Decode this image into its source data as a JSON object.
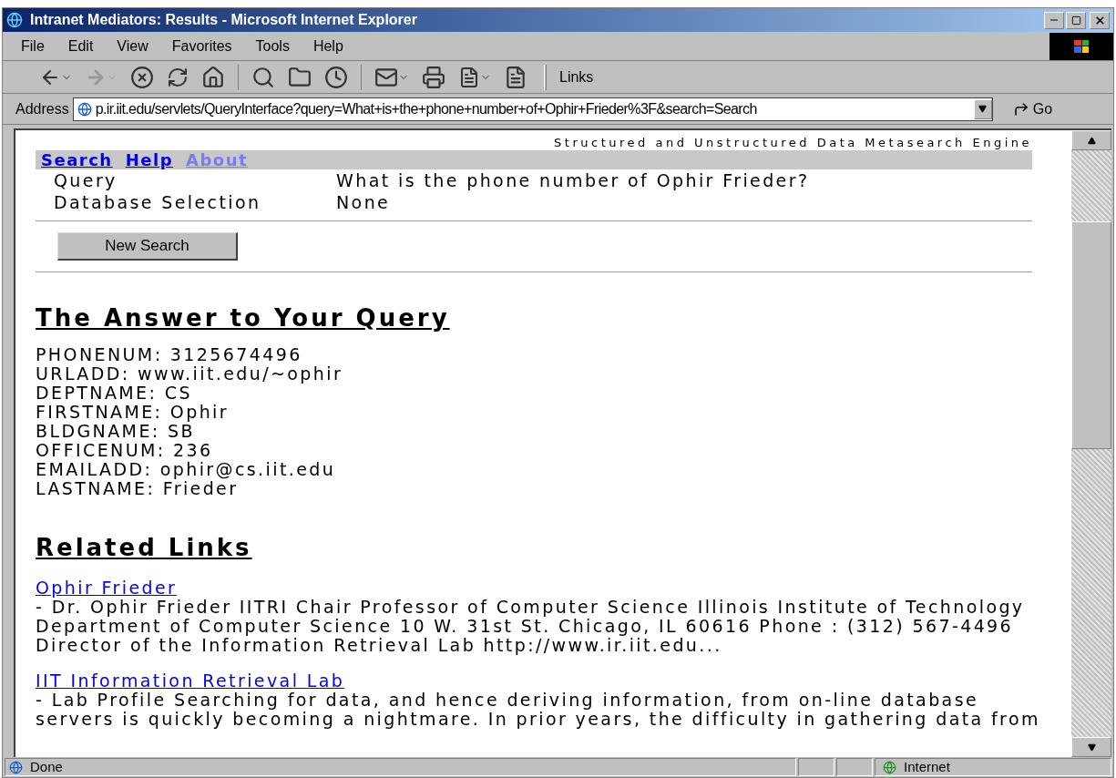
{
  "window": {
    "title": "Intranet Mediators: Results - Microsoft Internet Explorer"
  },
  "menu": [
    "File",
    "Edit",
    "View",
    "Favorites",
    "Tools",
    "Help"
  ],
  "toolbar": {
    "links_label": "Links"
  },
  "address": {
    "label": "Address",
    "value": "p.ir.iit.edu/servlets/QueryInterface?query=What+is+the+phone+number+of+Ophir+Frieder%3F&search=Search",
    "go": "Go"
  },
  "page": {
    "tagline": "Structured and Unstructured Data Metasearch Engine",
    "nav": [
      {
        "label": "Search",
        "disabled": false
      },
      {
        "label": "Help",
        "disabled": false
      },
      {
        "label": "About",
        "disabled": true
      }
    ],
    "summary": [
      {
        "label": "Query",
        "value": "What is the phone number of Ophir Frieder?"
      },
      {
        "label": "Database Selection",
        "value": "None"
      }
    ],
    "new_search_button": "New Search",
    "answer_heading": "The Answer to Your Query",
    "answer_lines": [
      "PHONENUM: 3125674496",
      "URLADD: www.iit.edu/~ophir",
      "DEPTNAME: CS",
      "FIRSTNAME: Ophir",
      "BLDGNAME: SB",
      "OFFICENUM: 236",
      "EMAILADD: ophir@cs.iit.edu",
      "LASTNAME: Frieder"
    ],
    "related_heading": "Related Links",
    "related_links": [
      {
        "title": "Ophir Frieder",
        "description_lines": [
          "- Dr. Ophir Frieder IITRI Chair Professor of Computer Science Illinois Institute of Technology",
          "Department of Computer Science 10 W. 31st St. Chicago, IL 60616 Phone : (312) 567-4496",
          "Director of the Information Retrieval Lab http://www.ir.iit.edu..."
        ]
      },
      {
        "title": "IIT Information Retrieval Lab",
        "description_lines": [
          "- Lab Profile Searching for data, and hence deriving information, from on-line database",
          "servers is quickly becoming a nightmare. In prior years, the difficulty in gathering data from"
        ]
      }
    ]
  },
  "status_bar": {
    "text": "Done",
    "zone": "Internet"
  }
}
